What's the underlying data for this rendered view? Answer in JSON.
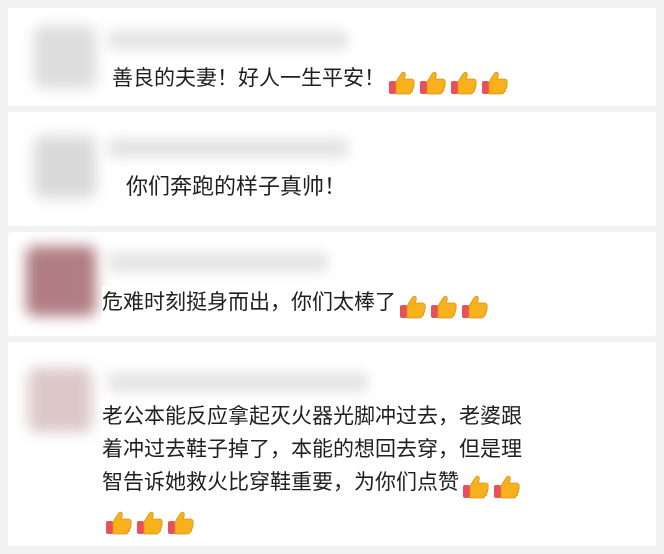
{
  "comments": [
    {
      "text": "善良的夫妻！好人一生平安！",
      "thumbs_count": 4,
      "avatar_color": "#dcdcdc"
    },
    {
      "text": "你们奔跑的样子真帅！",
      "thumbs_count": 0,
      "avatar_color": "#d9d9d9"
    },
    {
      "text": "危难时刻挺身而出，你们太棒了",
      "thumbs_count": 3,
      "avatar_color": "#b07d84"
    },
    {
      "lines": [
        "老公本能反应拿起灭火器光脚冲过去，老婆跟",
        "着冲过去鞋子掉了，本能的想回去穿，但是理",
        "智告诉她救火比穿鞋重要，为你们点赞"
      ],
      "thumbs_line3_count": 2,
      "thumbs_line4_count": 3,
      "avatar_color": "#dcc8c8"
    }
  ],
  "icons": {
    "thumbs": "thumbs-up-emoji-icon"
  },
  "colors": {
    "thumb_yellow": "#f7b11c",
    "thumb_cuff": "#e8505b",
    "background": "#f2f2f2"
  }
}
